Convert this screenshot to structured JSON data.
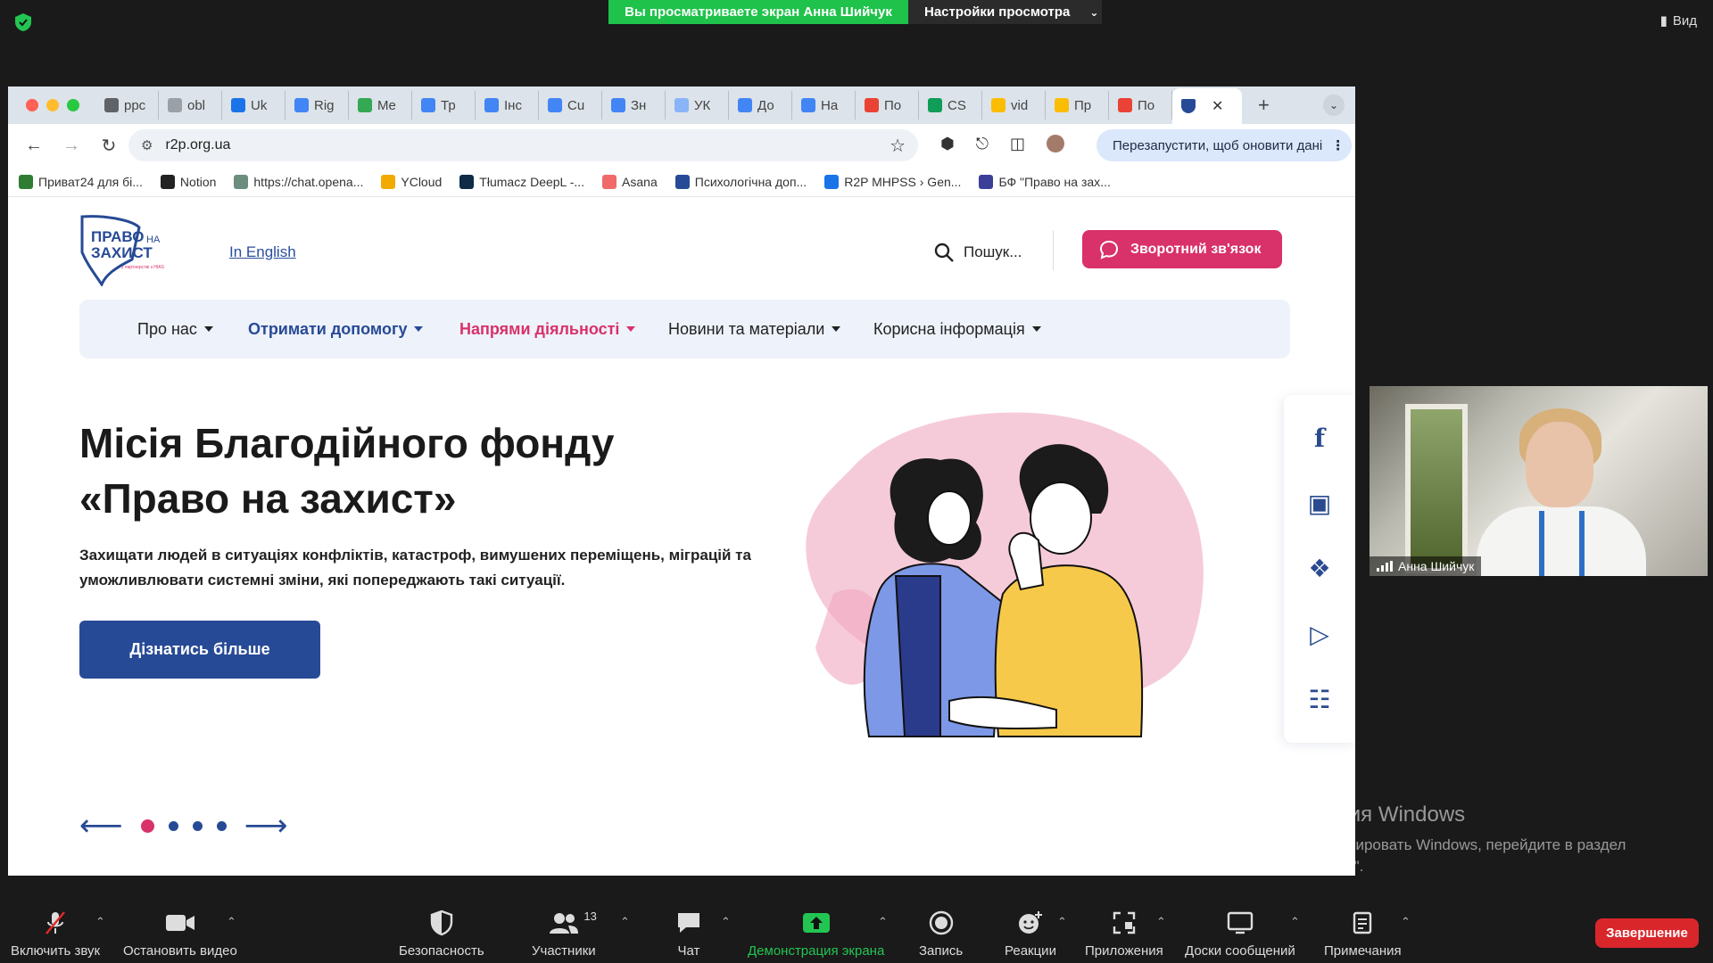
{
  "zoom_top": {
    "sharing_banner": "Вы просматриваете экран Анна Шийчук",
    "view_settings": "Настройки просмотра",
    "view_button": "Вид"
  },
  "browser": {
    "tabs": [
      {
        "label": "ppc",
        "color": "#5f6368"
      },
      {
        "label": "obl",
        "color": "#9aa0a6"
      },
      {
        "label": "Uk",
        "color": "#1a73e8"
      },
      {
        "label": "Rig",
        "color": "#4285f4"
      },
      {
        "label": "Me",
        "color": "#34a853"
      },
      {
        "label": "Тр",
        "color": "#4285f4"
      },
      {
        "label": "Інс",
        "color": "#4285f4"
      },
      {
        "label": "Cu",
        "color": "#4285f4"
      },
      {
        "label": "Зн",
        "color": "#4285f4"
      },
      {
        "label": "УК",
        "color": "#8ab4f8"
      },
      {
        "label": "До",
        "color": "#4285f4"
      },
      {
        "label": "На",
        "color": "#4285f4"
      },
      {
        "label": "По",
        "color": "#ea4335"
      },
      {
        "label": "CS",
        "color": "#0f9d58"
      },
      {
        "label": "vid",
        "color": "#fbbc04"
      },
      {
        "label": "Пр",
        "color": "#fbbc04"
      },
      {
        "label": "По",
        "color": "#ea4335"
      }
    ],
    "active_tab_color": "#274a96",
    "url": "r2p.org.ua",
    "update_button": "Перезапустити, щоб оновити дані",
    "bookmarks": [
      {
        "label": "Приват24 для бі...",
        "color": "#2e7d32"
      },
      {
        "label": "Notion",
        "color": "#222222"
      },
      {
        "label": "https://chat.opena...",
        "color": "#6b8e7f"
      },
      {
        "label": "YCloud",
        "color": "#f2a900"
      },
      {
        "label": "Tłumacz DeepL -...",
        "color": "#0f2b46"
      },
      {
        "label": "Asana",
        "color": "#f06a6a"
      },
      {
        "label": "Психологічна доп...",
        "color": "#274a96"
      },
      {
        "label": "R2P MHPSS › Gen...",
        "color": "#1a73e8"
      },
      {
        "label": "БФ \"Право на зах...",
        "color": "#3b3f99"
      }
    ]
  },
  "site": {
    "logo_text_1": "ПРАВО",
    "logo_text_2": "НА",
    "logo_text_3": "ЗАХИСТ",
    "logo_partner": "у партнерстві з НІАS",
    "in_english": "In English",
    "search_placeholder": "Пошук...",
    "feedback_button": "Зворотний зв'язок",
    "nav": [
      {
        "label": "Про нас",
        "color": "#222222",
        "bold": false
      },
      {
        "label": "Отримати допомогу",
        "color": "#274a96",
        "bold": true
      },
      {
        "label": "Напрями діяльності",
        "color": "#d9316a",
        "bold": true
      },
      {
        "label": "Новини та матеріали",
        "color": "#222222",
        "bold": false
      },
      {
        "label": "Корисна інформація",
        "color": "#222222",
        "bold": false
      }
    ],
    "hero_title_1": "Місія Благодійного фонду",
    "hero_title_2": "«Право на захист»",
    "hero_subtitle": "Захищати людей в ситуаціях конфліктів, катастроф, вимушених переміщень, міграцій та уможливлювати системні зміни, які попереджають такі ситуації.",
    "learn_more": "Дізнатись більше",
    "social_icons": [
      "facebook-icon",
      "instagram-icon",
      "twitter-icon",
      "youtube-icon",
      "bot-icon"
    ],
    "slider_dots": 4,
    "slider_active": 1,
    "accent": "#d9316a",
    "primary": "#274a96"
  },
  "video": {
    "participant_name": "Анна Шийчук"
  },
  "windows_activation": {
    "title": "Активация Windows",
    "text": "Чтобы активировать Windows, перейдите в раздел \"Параметры\"."
  },
  "zoom_bottom": {
    "unmute": "Включить звук",
    "stop_video": "Остановить видео",
    "security": "Безопасность",
    "participants": "Участники",
    "participants_count": "13",
    "chat": "Чат",
    "share_screen": "Демонстрация экрана",
    "record": "Запись",
    "reactions": "Реакции",
    "apps": "Приложения",
    "whiteboards": "Доски сообщений",
    "notes": "Примечания",
    "end": "Завершение"
  }
}
